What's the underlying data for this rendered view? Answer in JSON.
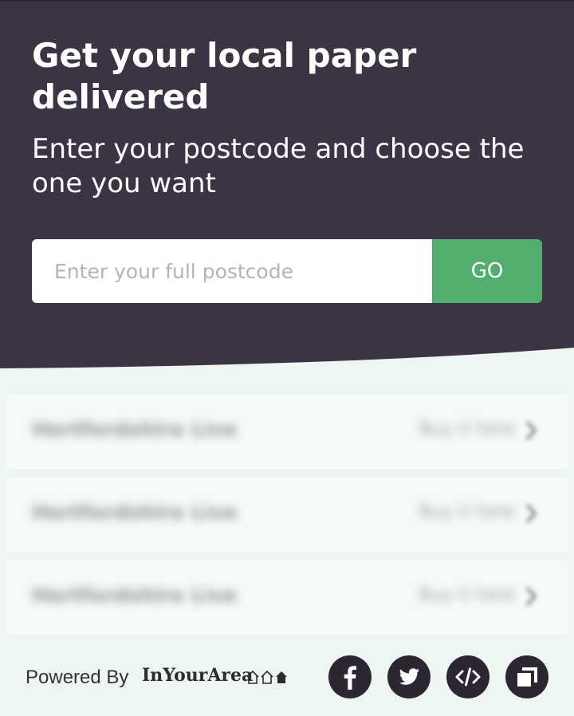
{
  "header": {
    "title": "Get your local paper delivered",
    "subtitle": "Enter your postcode and choose the one you want"
  },
  "search": {
    "placeholder": "Enter your full postcode",
    "value": "",
    "button_label": "GO"
  },
  "results": [
    {
      "name": "Hertfordshire Live",
      "action": "Buy it here"
    },
    {
      "name": "Hertfordshire Live",
      "action": "Buy it here"
    },
    {
      "name": "Hertfordshire Live",
      "action": "Buy it here"
    }
  ],
  "footer": {
    "powered_by": "Powered By",
    "brand": "InYourArea",
    "social_icons": [
      "facebook-icon",
      "twitter-icon",
      "embed-code-icon",
      "copy-icon"
    ]
  },
  "colors": {
    "header_bg": "#3c3445",
    "go_button": "#52ae6e",
    "results_bg": "#eef6f1",
    "social_bg": "#2c2632"
  }
}
